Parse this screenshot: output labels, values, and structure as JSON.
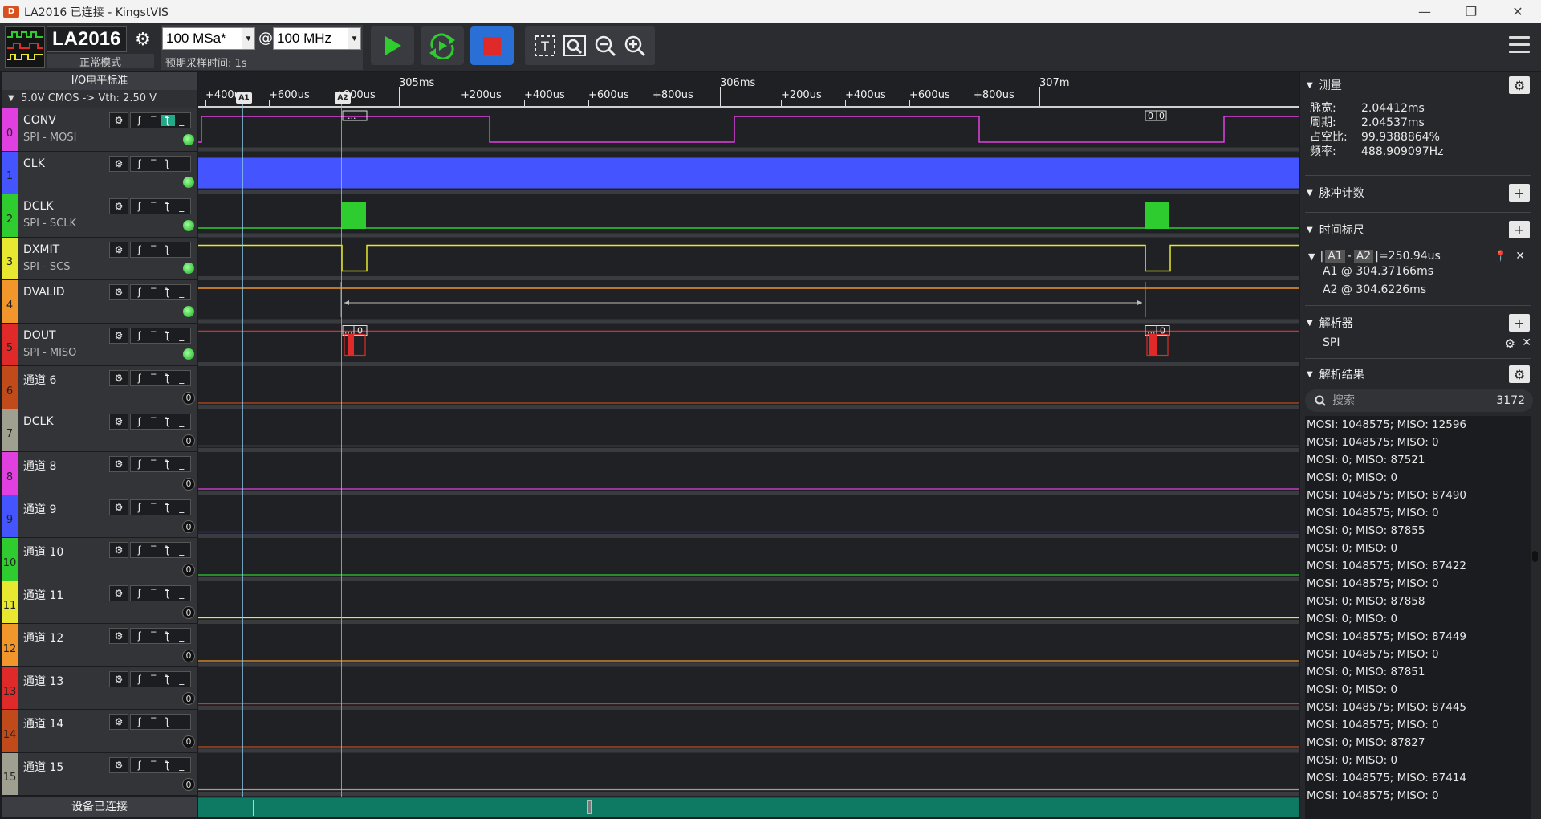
{
  "window": {
    "title": "LA2016 已连接 - KingstVIS",
    "app_icon_text": "D"
  },
  "toolbar": {
    "device_name": "LA2016",
    "mode": "正常模式",
    "sample_rate": "100 MSa*",
    "at": "@",
    "sample_freq": "100 MHz",
    "expected_time": "预期采样时间: 1s"
  },
  "left": {
    "header": "I/O电平标准",
    "vth": "5.0V CMOS  -> Vth: 2.50 V",
    "footer": "设备已连接"
  },
  "channels": [
    {
      "idx": "0",
      "name": "CONV",
      "sub": "SPI - MOSI",
      "color": "#e040e0",
      "active": true
    },
    {
      "idx": "1",
      "name": "CLK",
      "sub": "",
      "color": "#4455ff",
      "active": true
    },
    {
      "idx": "2",
      "name": "DCLK",
      "sub": "SPI - SCLK",
      "color": "#2ecc2e",
      "active": true
    },
    {
      "idx": "3",
      "name": "DXMIT",
      "sub": "SPI - SCS",
      "color": "#e8e830",
      "active": true
    },
    {
      "idx": "4",
      "name": "DVALID",
      "sub": "",
      "color": "#f0962a",
      "active": true
    },
    {
      "idx": "5",
      "name": "DOUT",
      "sub": "SPI - MISO",
      "color": "#e02a2a",
      "active": true
    },
    {
      "idx": "6",
      "name": "通道 6",
      "sub": "",
      "color": "#c04a1a",
      "active": false
    },
    {
      "idx": "7",
      "name": "DCLK",
      "sub": "",
      "color": "#a0a090",
      "active": false
    },
    {
      "idx": "8",
      "name": "通道 8",
      "sub": "",
      "color": "#e040e0",
      "active": false
    },
    {
      "idx": "9",
      "name": "通道 9",
      "sub": "",
      "color": "#4455ff",
      "active": false
    },
    {
      "idx": "10",
      "name": "通道 10",
      "sub": "",
      "color": "#2ecc2e",
      "active": false
    },
    {
      "idx": "11",
      "name": "通道 11",
      "sub": "",
      "color": "#e8e830",
      "active": false
    },
    {
      "idx": "12",
      "name": "通道 12",
      "sub": "",
      "color": "#f0962a",
      "active": false
    },
    {
      "idx": "13",
      "name": "通道 13",
      "sub": "",
      "color": "#e02a2a",
      "active": false
    },
    {
      "idx": "14",
      "name": "通道 14",
      "sub": "",
      "color": "#c04a1a",
      "active": false
    },
    {
      "idx": "15",
      "name": "通道 15",
      "sub": "",
      "color": "#a0a090",
      "active": false
    }
  ],
  "channel_zero": "0",
  "ruler": {
    "major": [
      "305ms",
      "306ms",
      "307m"
    ],
    "minor": [
      "+400us",
      "+600us",
      "+800us",
      "+200us",
      "+400us",
      "+600us",
      "+800us",
      "+200us",
      "+400us",
      "+600us",
      "+800us"
    ]
  },
  "cursors": {
    "a1": "A1",
    "a2": "A2"
  },
  "wave_labels": {
    "conv_a": "...",
    "conv_b": "0",
    "conv_c": "0",
    "dout_a": "...",
    "dout_b": "0",
    "dout_c": "...",
    "dout_d": "0"
  },
  "measure": {
    "title": "测量",
    "items": [
      {
        "k": "脉宽:",
        "v": "2.04412ms"
      },
      {
        "k": "周期:",
        "v": "2.04537ms"
      },
      {
        "k": "占空比:",
        "v": "99.9388864%"
      },
      {
        "k": "频率:",
        "v": "488.909097Hz"
      }
    ]
  },
  "pulse_count": {
    "title": "脉冲计数"
  },
  "time_ruler": {
    "title": "时间标尺",
    "a1": "A1",
    "a2": "A2",
    "diff": "=250.94us",
    "a1_pos": "A1 @ 304.37166ms",
    "a2_pos": "A2 @ 304.6226ms"
  },
  "analyzer": {
    "title": "解析器",
    "item": "SPI"
  },
  "results": {
    "title": "解析结果",
    "search_placeholder": "搜索",
    "count": "3172",
    "rows": [
      "MOSI: 1048575;  MISO: 12596",
      "MOSI: 1048575;  MISO: 0",
      "MOSI: 0;  MISO: 87521",
      "MOSI: 0;  MISO: 0",
      "MOSI: 1048575;  MISO: 87490",
      "MOSI: 1048575;  MISO: 0",
      "MOSI: 0;  MISO: 87855",
      "MOSI: 0;  MISO: 0",
      "MOSI: 1048575;  MISO: 87422",
      "MOSI: 1048575;  MISO: 0",
      "MOSI: 0;  MISO: 87858",
      "MOSI: 0;  MISO: 0",
      "MOSI: 1048575;  MISO: 87449",
      "MOSI: 1048575;  MISO: 0",
      "MOSI: 0;  MISO: 87851",
      "MOSI: 0;  MISO: 0",
      "MOSI: 1048575;  MISO: 87445",
      "MOSI: 1048575;  MISO: 0",
      "MOSI: 0;  MISO: 87827",
      "MOSI: 0;  MISO: 0",
      "MOSI: 1048575;  MISO: 87414",
      "MOSI: 1048575;  MISO: 0"
    ]
  }
}
